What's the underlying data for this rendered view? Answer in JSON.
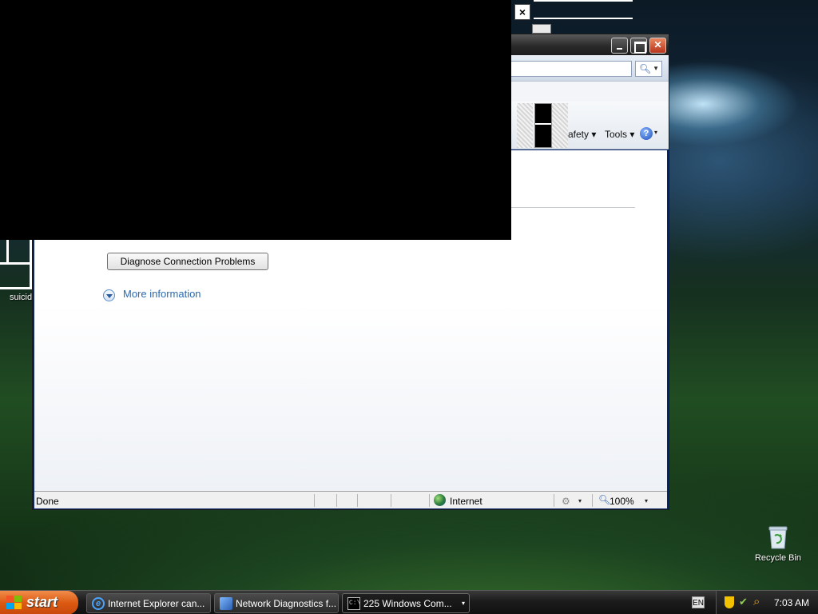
{
  "desktop": {
    "icons": [
      {
        "label": "Recycle Bin"
      },
      {
        "label": "suicid"
      }
    ]
  },
  "background_window": {
    "close_glyph": "×"
  },
  "ie_window": {
    "title_buttons": {
      "minimize": "",
      "maximize": "",
      "close": "✕"
    },
    "search": {
      "placeholder": ""
    },
    "command_bar": {
      "safety_label": "afety ▾",
      "tools_label": "Tools ▾",
      "help_glyph": "?",
      "help_dropdown": "▾"
    },
    "content": {
      "diagnose_button": "Diagnose Connection Problems",
      "more_info_link": "More information"
    },
    "status_bar": {
      "status_text": "Done",
      "zone_label": "Internet",
      "zoom_label": "100%",
      "dropdown": "▾"
    }
  },
  "taskbar": {
    "start_label": "start",
    "tasks": [
      {
        "label": "Internet Explorer can...",
        "icon": "ie-icon"
      },
      {
        "label": "Network Diagnostics f...",
        "icon": "network-diagnostics-icon"
      },
      {
        "label": "225 Windows Com...",
        "icon": "command-prompt-icon"
      }
    ],
    "task_group_dropdown": "▾",
    "language": "EN",
    "clock": "7:03 AM"
  },
  "colors": {
    "start_button": "#dc5a12",
    "link": "#2a6ab2",
    "close_button": "#b8341c"
  }
}
